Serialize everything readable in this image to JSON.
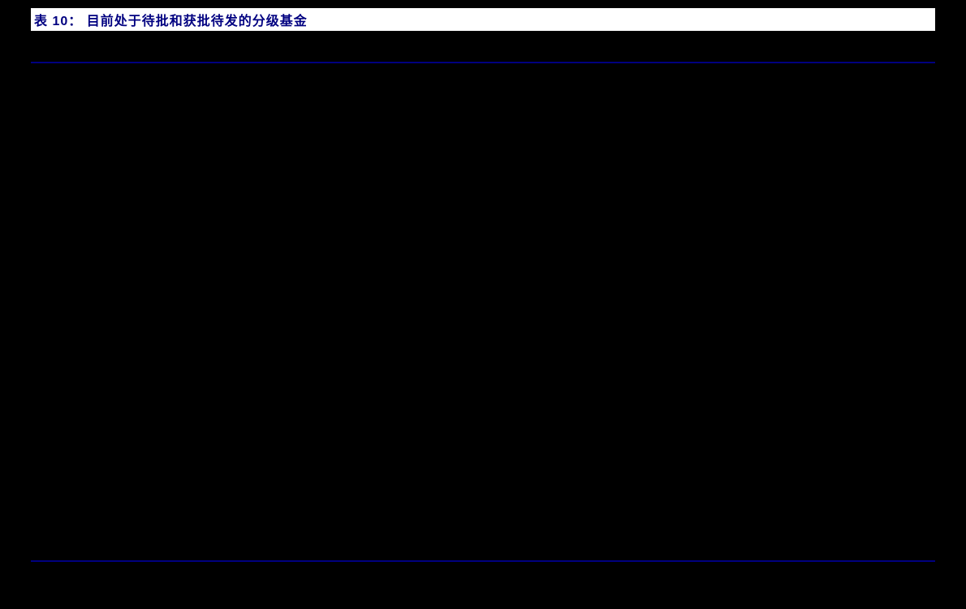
{
  "panel": {
    "title": "表 10： 目前处于待批和获批待发的分级基金"
  },
  "chart_data": {
    "type": "table",
    "title": "表 10： 目前处于待批和获批待发的分级基金",
    "columns": [],
    "rows": [],
    "note": "Body region of the table is rendered as solid black in the image; no cell values are visible."
  }
}
